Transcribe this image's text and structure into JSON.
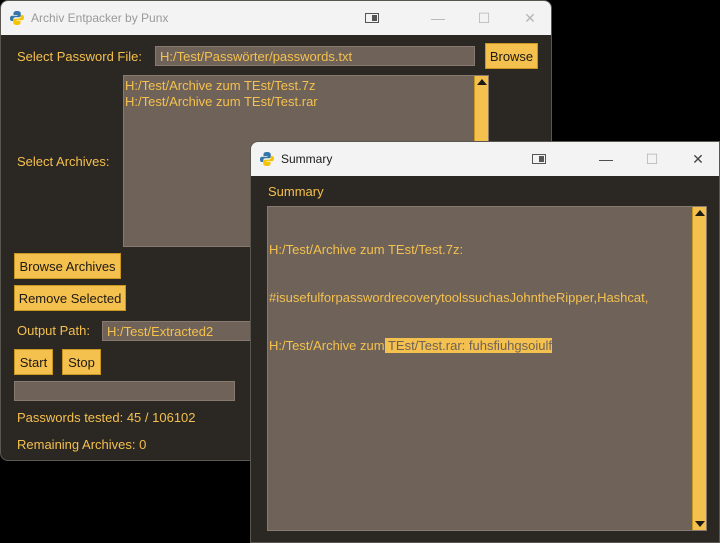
{
  "main_window": {
    "title": "Archiv Entpacker by Punx",
    "password_file_label": "Select Password File:",
    "password_file_value": "H:/Test/Passwörter/passwords.txt",
    "browse_label": "Browse",
    "archives_label": "Select Archives:",
    "archives": [
      "H:/Test/Archive zum TEst/Test.7z",
      "H:/Test/Archive zum TEst/Test.rar"
    ],
    "browse_archives_label": "Browse Archives",
    "remove_selected_label": "Remove Selected",
    "output_path_label": "Output Path:",
    "output_path_value": "H:/Test/Extracted2",
    "start_label": "Start",
    "stop_label": "Stop",
    "progress_fraction": 0.0,
    "passwords_tested": "Passwords tested: 45 / 106102",
    "remaining_archives": "Remaining Archives: 0"
  },
  "summary_window": {
    "title": "Summary",
    "heading": "Summary",
    "line1": "H:/Test/Archive zum TEst/Test.7z:",
    "line2": "#isusefulforpasswordrecoverytoolssuchasJohntheRipper,Hashcat,",
    "line3_prefix": "H:/Test/Archive zum",
    "line3_selected": " TEst/Test.rar: fuhsfiuhgsoiulf"
  },
  "colors": {
    "background": "#2b2722",
    "accent": "#f4c04e",
    "field": "#6f6359"
  },
  "icons": {
    "app": "python-icon",
    "snap": "snap-layout-icon",
    "minimize": "minimize-icon",
    "maximize": "maximize-icon",
    "close": "close-icon"
  }
}
